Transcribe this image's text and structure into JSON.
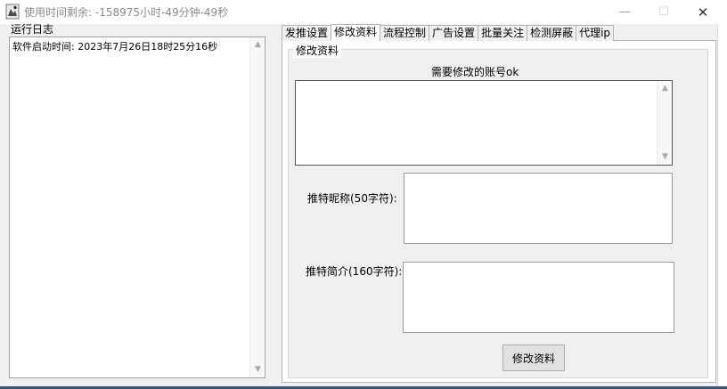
{
  "window": {
    "title": "使用时间剩余:  -158975小时-49分钟-49秒",
    "icons": {
      "app": "app-logo-icon",
      "minimize": "minimize-icon",
      "maximize": "maximize-icon",
      "close": "close-icon"
    },
    "minimize_glyph": "—",
    "maximize_glyph": "☐",
    "close_glyph": "✕"
  },
  "log": {
    "title": "运行日志",
    "lines": [
      "软件启动时间: 2023年7月26日18时25分16秒"
    ]
  },
  "tabs": [
    {
      "label": "发推设置",
      "active": false
    },
    {
      "label": "修改资料",
      "active": true
    },
    {
      "label": "流程控制",
      "active": false
    },
    {
      "label": "广告设置",
      "active": false
    },
    {
      "label": "批量关注",
      "active": false
    },
    {
      "label": "检测屏蔽",
      "active": false
    },
    {
      "label": "代理ip",
      "active": false
    }
  ],
  "profile": {
    "group_label": "修改资料",
    "account_label": "需要修改的账号ok",
    "account_value": "",
    "nickname_label": "推特昵称(50字符):",
    "nickname_value": "",
    "bio_label": "推特简介(160字符):",
    "bio_value": "",
    "submit_label": "修改资料"
  },
  "scroll": {
    "up_glyph": "▲",
    "down_glyph": "▼"
  },
  "colors": {
    "taskbar": "#2b5797",
    "client_bg": "#f0f0f0",
    "title_text": "#8a8a8a"
  }
}
